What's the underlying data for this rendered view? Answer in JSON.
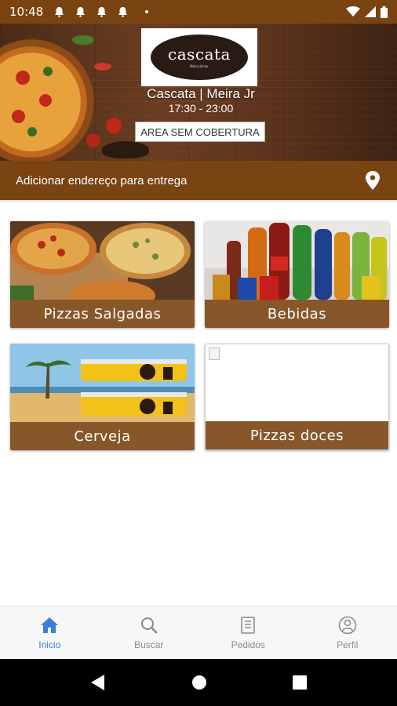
{
  "status_bar": {
    "time": "10:48",
    "notification_icons": [
      "bell-icon",
      "bell-icon",
      "bell-icon",
      "bell-icon"
    ],
    "right_icons": [
      "wifi-icon",
      "signal-icon",
      "battery-icon"
    ]
  },
  "header": {
    "logo_text": "cascata",
    "logo_subtext": "Meira Júnior",
    "store_name": "Cascata | Meira Jr",
    "hours": "17:30 - 23:00",
    "coverage_badge": "AREA SEM COBERTURA"
  },
  "address_bar": {
    "label": "Adicionar endereço para entrega",
    "icon": "location-pin-icon"
  },
  "categories": [
    {
      "label": "Pizzas Salgadas",
      "image": "pizzas-image"
    },
    {
      "label": "Bebidas",
      "image": "drinks-image"
    },
    {
      "label": "Cerveja",
      "image": "beer-image"
    },
    {
      "label": "Pizzas doces",
      "image": "broken-image"
    }
  ],
  "bottom_nav": {
    "active": "Inicio",
    "items": [
      {
        "label": "Inicio",
        "icon": "home-icon"
      },
      {
        "label": "Buscar",
        "icon": "search-icon"
      },
      {
        "label": "Pedidos",
        "icon": "orders-icon"
      },
      {
        "label": "Perfil",
        "icon": "profile-icon"
      }
    ]
  },
  "colors": {
    "brand": "#7a4412",
    "active_nav": "#3a7fd6",
    "inactive_nav": "#8a8a8a"
  }
}
